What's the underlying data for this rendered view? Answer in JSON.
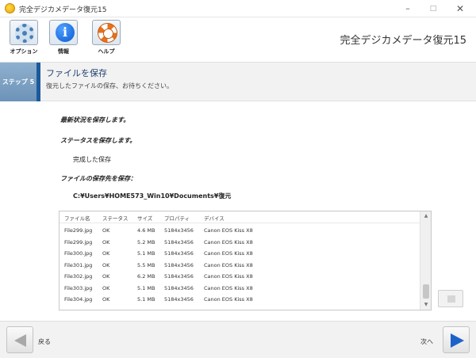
{
  "window": {
    "title": "完全デジカメデータ復元15",
    "controls": {
      "minimize": "–",
      "maximize": "□",
      "close": "✕"
    }
  },
  "toolbar": {
    "items": [
      {
        "label": "オプション",
        "icon": "gear-icon"
      },
      {
        "label": "情報",
        "icon": "info-icon"
      },
      {
        "label": "ヘルプ",
        "icon": "lifebuoy-icon"
      }
    ],
    "app_title": "完全デジカメデータ復元15"
  },
  "step": {
    "label": "ステップ 5",
    "title": "ファイルを保存",
    "subtitle": "復元したファイルの保存、お待ちください。"
  },
  "content": {
    "line1": "最新状況を保存します。",
    "line2": "ステータスを保存します。",
    "status": "完成した保存",
    "line3": "ファイルの保存先を保存：",
    "path": "C:¥Users¥HOME573_Win10¥Documents¥復元"
  },
  "file_list": {
    "columns": [
      "ファイル名",
      "ステータス",
      "サイズ",
      "プロパティ",
      "デバイス"
    ],
    "rows": [
      [
        "File299.jpg",
        "OK",
        "4.6 MB",
        "5184x3456",
        "Canon EOS Kiss X8"
      ],
      [
        "File299.jpg",
        "OK",
        "5.2 MB",
        "5184x3456",
        "Canon EOS Kiss X8"
      ],
      [
        "File300.jpg",
        "OK",
        "5.1 MB",
        "5184x3456",
        "Canon EOS Kiss X8"
      ],
      [
        "File301.jpg",
        "OK",
        "5.5 MB",
        "5184x3456",
        "Canon EOS Kiss X8"
      ],
      [
        "File302.jpg",
        "OK",
        "6.2 MB",
        "5184x3456",
        "Canon EOS Kiss X8"
      ],
      [
        "File303.jpg",
        "OK",
        "5.1 MB",
        "5184x3456",
        "Canon EOS Kiss X8"
      ],
      [
        "File304.jpg",
        "OK",
        "5.1 MB",
        "5184x3456",
        "Canon EOS Kiss X8"
      ]
    ]
  },
  "nav": {
    "back_label": "戻る",
    "next_label": "次へ"
  },
  "colors": {
    "accent": "#1c5a9c",
    "step_bg": "#7ea2c4",
    "next_arrow": "#1c63c9"
  }
}
